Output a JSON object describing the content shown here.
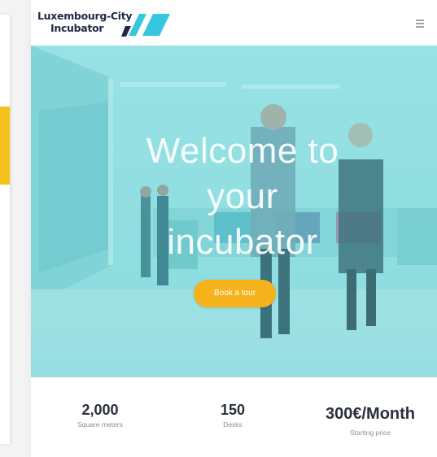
{
  "logo": {
    "line1": "Luxembourg-City",
    "line2": "Incubator"
  },
  "hero": {
    "title_line1": "Welcome to",
    "title_line2": "your",
    "title_line3": "incubator",
    "cta_label": "Book a tour"
  },
  "stats": [
    {
      "value": "2,000",
      "label": "Square meters"
    },
    {
      "value": "150",
      "label": "Desks"
    },
    {
      "value": "300€/Month",
      "label": "Starting price"
    }
  ],
  "colors": {
    "accent": "#f6b21a",
    "brand_teal": "#34c8d8",
    "hero_tint": "#5acdd2",
    "text_dark": "#2a2f3d"
  }
}
